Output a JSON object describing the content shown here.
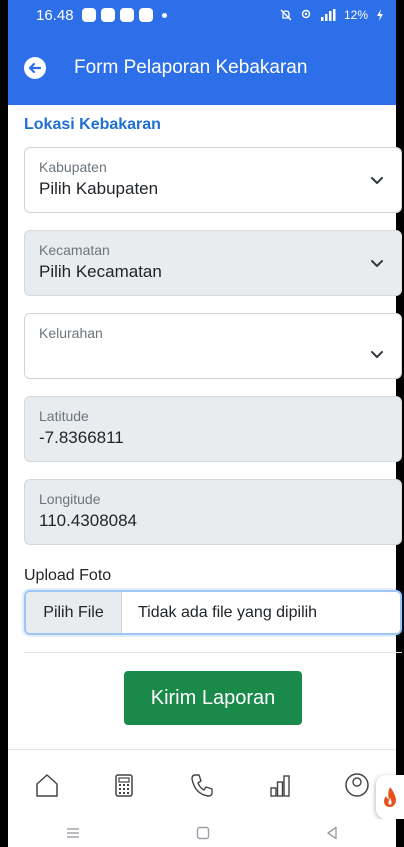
{
  "status_bar": {
    "time": "16.48",
    "right_text": "12%"
  },
  "app_bar": {
    "title": "Form Pelaporan Kebakaran",
    "back_icon": "back-arrow-icon"
  },
  "form": {
    "section_title": "Lokasi Kebakaran",
    "kabupaten": {
      "label": "Kabupaten",
      "value": "Pilih Kabupaten"
    },
    "kecamatan": {
      "label": "Kecamatan",
      "value": "Pilih Kecamatan"
    },
    "kelurahan": {
      "label": "Kelurahan",
      "value": ""
    },
    "latitude": {
      "label": "Latitude",
      "value": "-7.8366811"
    },
    "longitude": {
      "label": "Longitude",
      "value": "110.4308084"
    },
    "upload_label": "Upload Foto",
    "file_button": "Pilih File",
    "file_status": "Tidak ada file yang dipilih",
    "submit_label": "Kirim Laporan"
  },
  "bottom_nav": {
    "items": [
      "home-icon",
      "calculator-icon",
      "phone-icon",
      "bar-chart-icon",
      "profile-icon"
    ]
  },
  "colors": {
    "primary": "#2d6fe8",
    "section_title": "#1f6fd1",
    "submit": "#1a8a4a"
  }
}
